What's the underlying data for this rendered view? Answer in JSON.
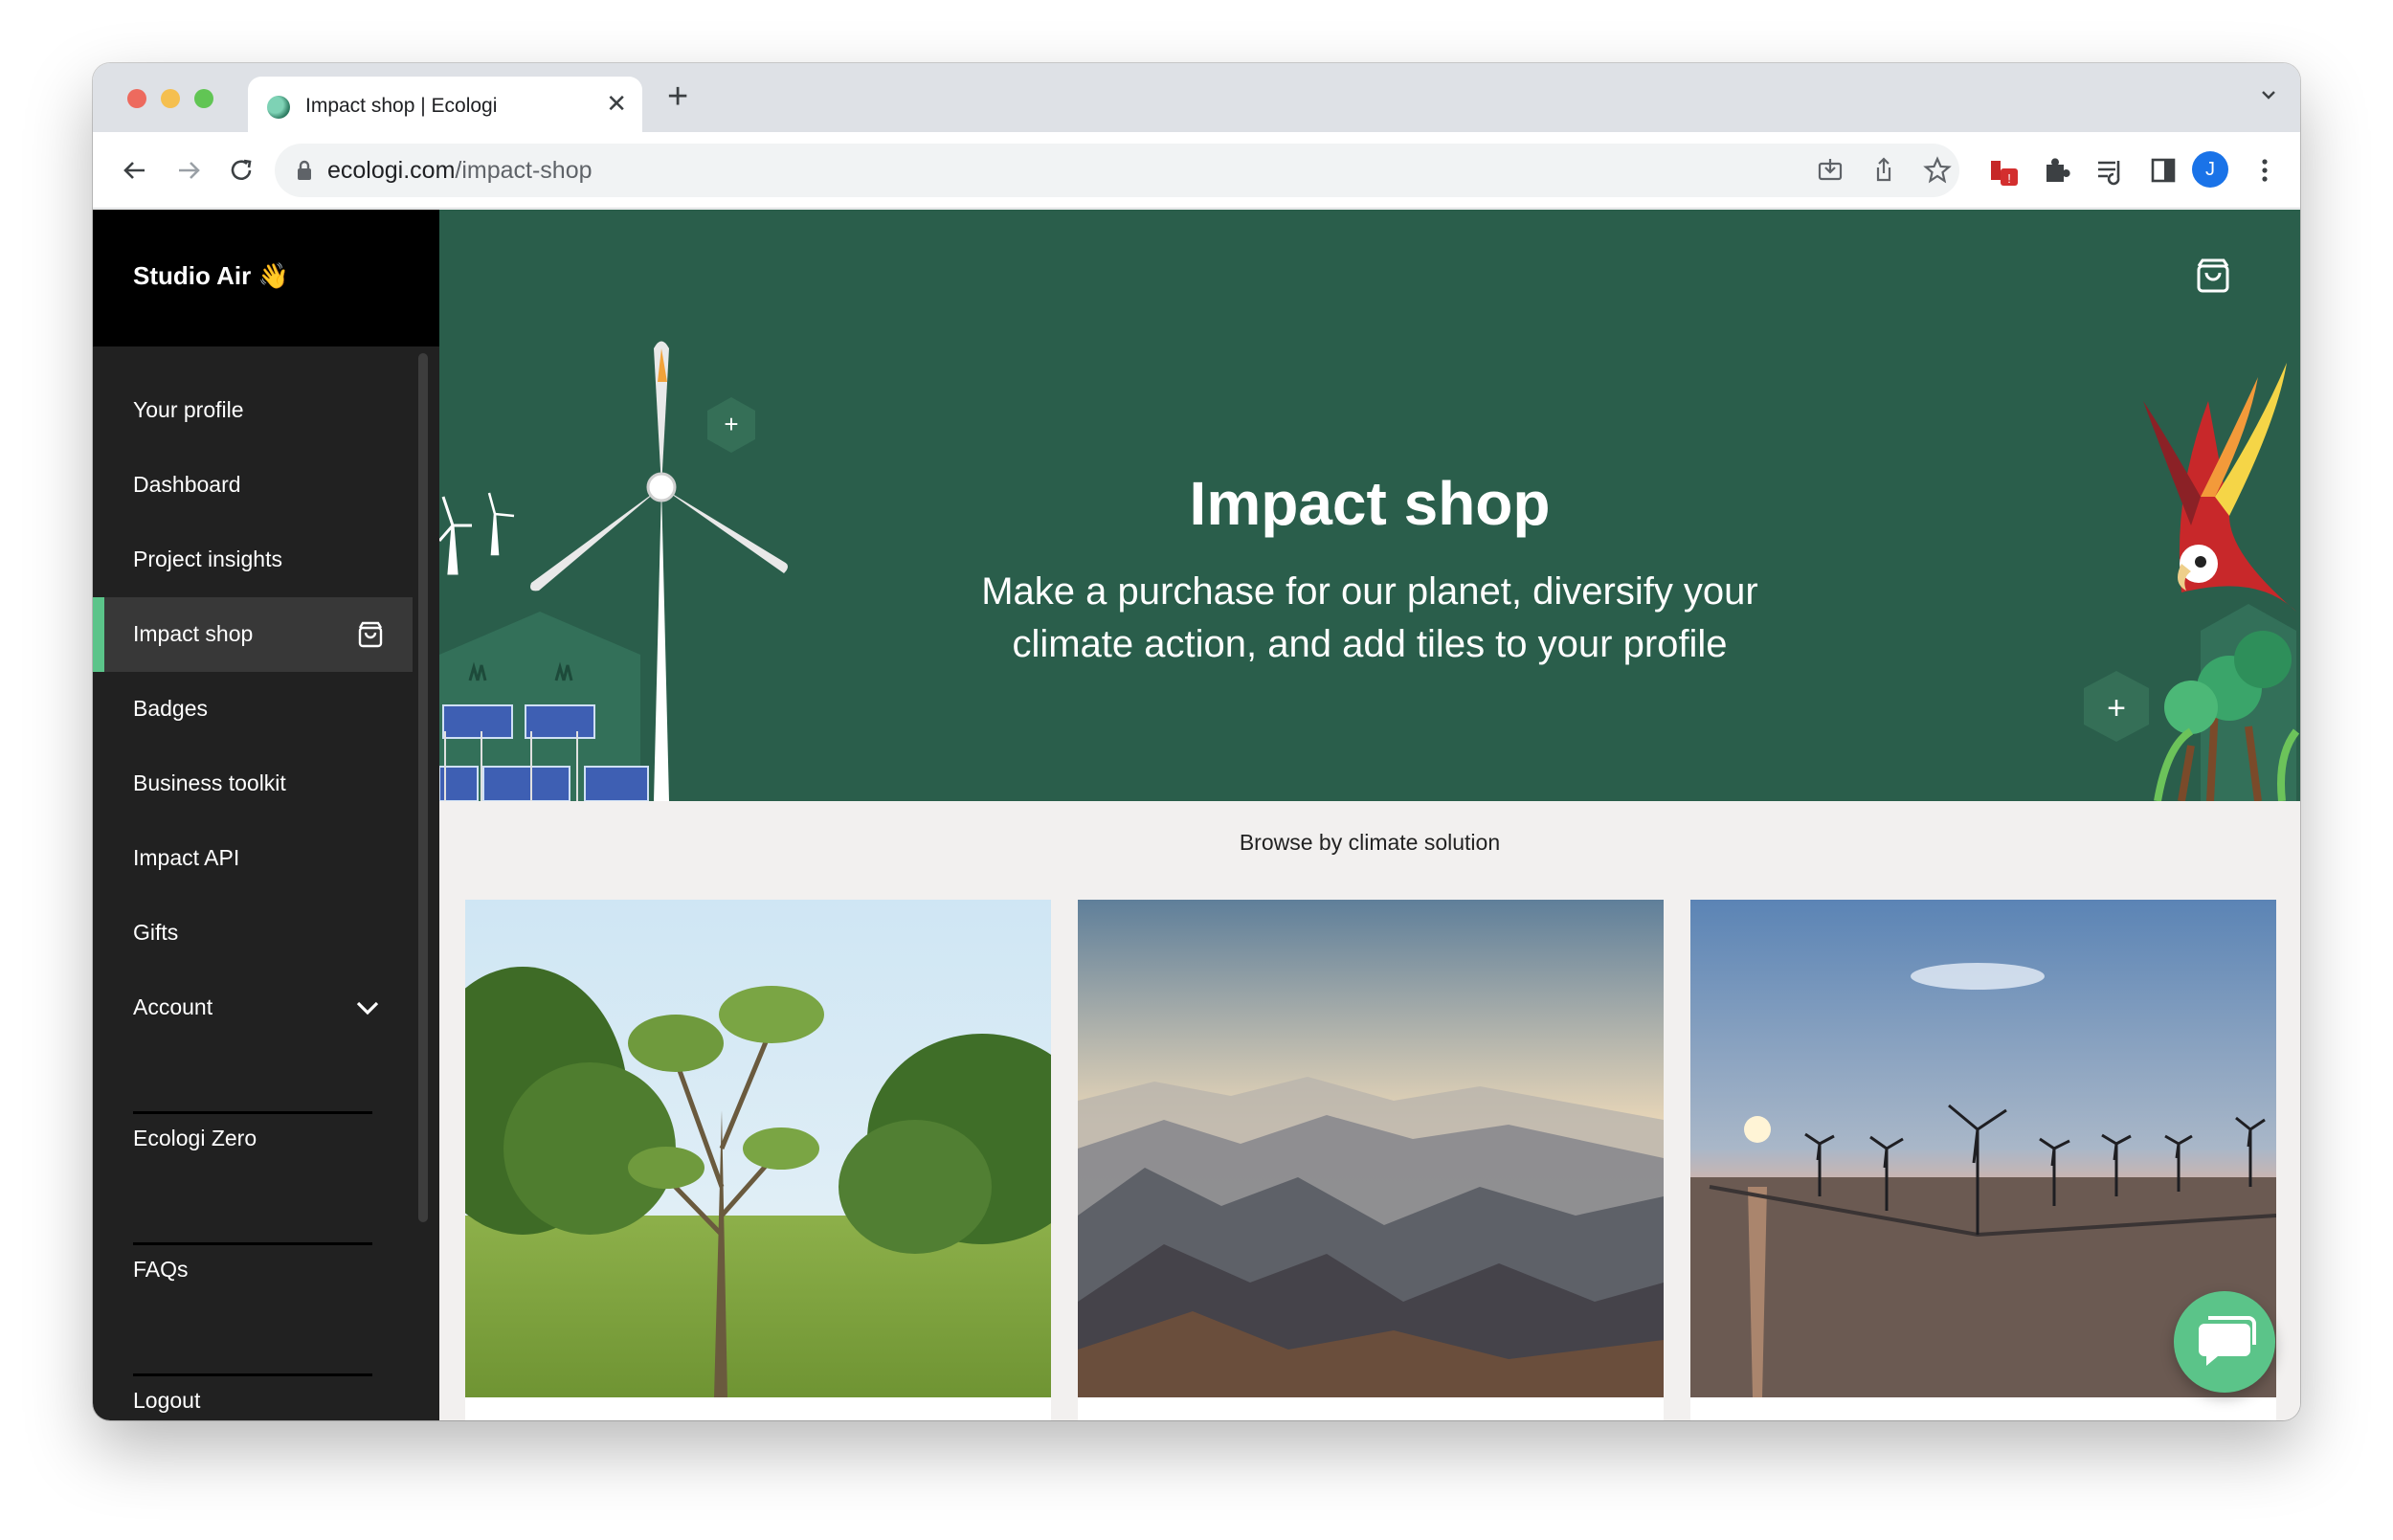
{
  "browser": {
    "tab_title": "Impact shop | Ecologi",
    "url_domain": "ecologi.com",
    "url_path": "/impact-shop",
    "avatar_letter": "J"
  },
  "sidebar": {
    "brand": "Studio Air",
    "brand_emoji": "👋",
    "items": [
      {
        "label": "Your profile"
      },
      {
        "label": "Dashboard"
      },
      {
        "label": "Project insights"
      },
      {
        "label": "Impact shop"
      },
      {
        "label": "Badges"
      },
      {
        "label": "Business toolkit"
      },
      {
        "label": "Impact API"
      },
      {
        "label": "Gifts"
      },
      {
        "label": "Account"
      },
      {
        "label": "Ecologi Zero"
      },
      {
        "label": "FAQs"
      },
      {
        "label": "Logout"
      }
    ]
  },
  "hero": {
    "title": "Impact shop",
    "subtitle": "Make a purchase for our planet, diversify your climate action, and add tiles to your profile",
    "background_color": "#2a5e4b"
  },
  "main": {
    "browse_label": "Browse by climate solution",
    "cards": [
      {
        "icon": "forest-photo"
      },
      {
        "icon": "mountains-photo"
      },
      {
        "icon": "wind-farm-photo"
      }
    ]
  },
  "colors": {
    "accent": "#5bc489",
    "sidebar_bg": "#212121",
    "sidebar_header_bg": "#000000"
  }
}
